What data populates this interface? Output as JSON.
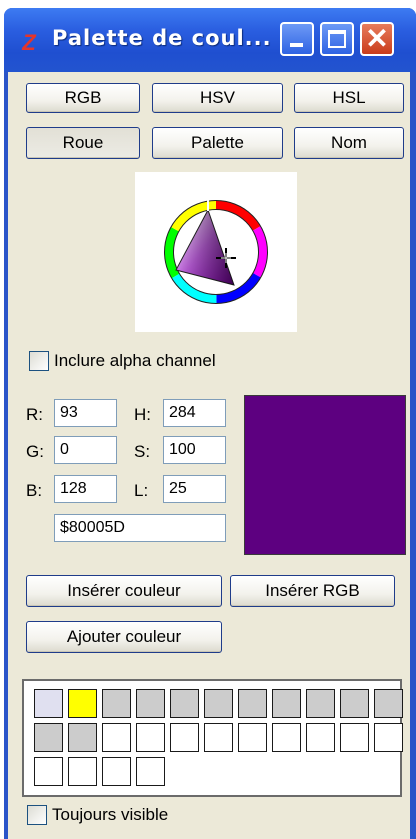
{
  "window": {
    "title": "Palette de coul...",
    "app_icon": "Z",
    "close_glyph": "✕"
  },
  "mode_buttons": [
    "RGB",
    "HSV",
    "HSL",
    "Roue",
    "Palette",
    "Nom"
  ],
  "alpha_checkbox": {
    "label": "Inclure alpha channel",
    "checked": false
  },
  "values": {
    "r_label": "R:",
    "r": "93",
    "g_label": "G:",
    "g": "0",
    "b_label": "B:",
    "b": "128",
    "h_label": "H:",
    "h": "284",
    "s_label": "S:",
    "s": "100",
    "l_label": "L:",
    "l": "25",
    "hex": "$80005D"
  },
  "current_color": "#5d0080",
  "actions": {
    "insert_color": "Insérer couleur",
    "insert_rgb": "Insérer RGB",
    "add_color": "Ajouter couleur"
  },
  "palette_colors": [
    "#e0e0f0",
    "#ffff00",
    "#cccccc",
    "#cccccc",
    "#cccccc",
    "#cccccc",
    "#cccccc",
    "#cccccc",
    "#cccccc",
    "#cccccc",
    "#cccccc",
    "#cccccc",
    "#cccccc",
    "#ffffff",
    "#ffffff",
    "#ffffff",
    "#ffffff",
    "#ffffff",
    "#ffffff",
    "#ffffff",
    "#ffffff",
    "#ffffff",
    "#ffffff",
    "#ffffff",
    "#ffffff",
    "#ffffff"
  ],
  "always_visible": {
    "label": "Toujours visible",
    "checked": false
  }
}
